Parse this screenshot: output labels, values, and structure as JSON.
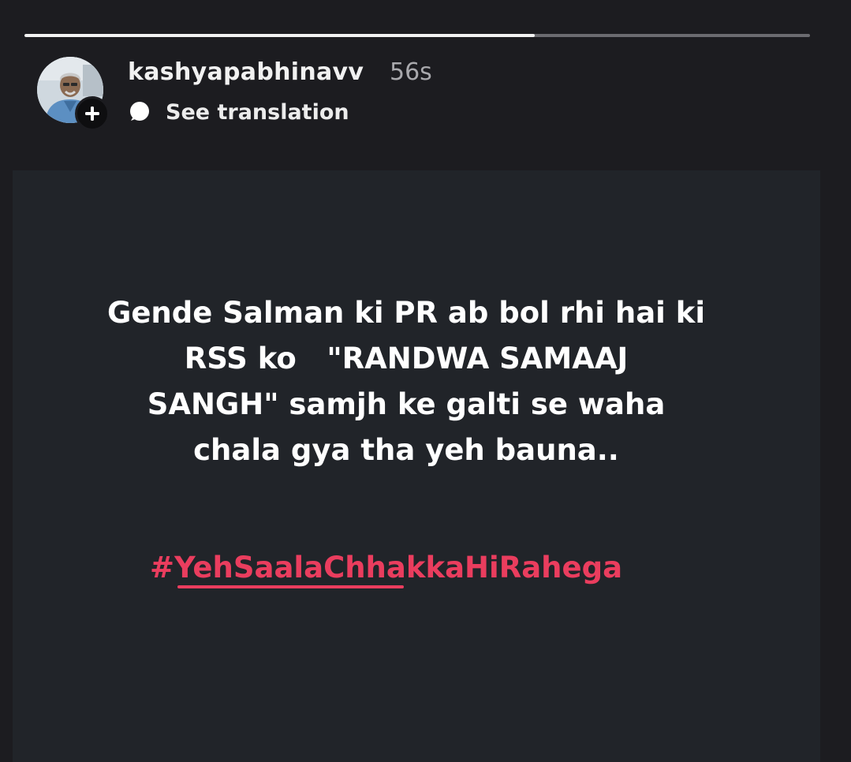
{
  "story": {
    "progress": 0.65,
    "username": "kashyapabhinavv",
    "time": "56s",
    "see_translation": "See translation",
    "avatar_icon": "profile-photo",
    "add_icon": "plus-icon",
    "translate_icon": "speech-bubble-icon",
    "caption": "Gende Salman ki PR ab bol rhi hai ki\nRSS ko   \"RANDWA SAMAAJ\nSANGH\" samjh ke galti se waha\nchala gya tha yeh bauna..",
    "hashtag": "#YehSaalaChhakkaHiRahega"
  },
  "colors": {
    "background": "#1c1c20",
    "card": "#212429",
    "text": "#ffffff",
    "muted": "#a9a9ad",
    "hashtag": "#ea3d5e"
  }
}
